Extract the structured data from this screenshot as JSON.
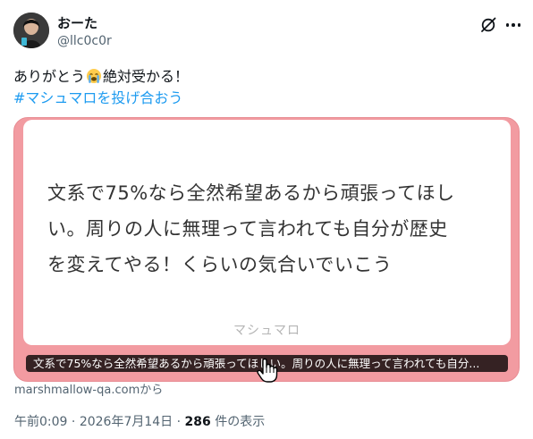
{
  "author": {
    "display_name": "おーた",
    "handle": "@llc0c0r"
  },
  "tweet": {
    "text_before_emoji": "ありがとう",
    "emoji": "loudly-crying-face-emoji",
    "text_after_emoji": "絶対受かる！",
    "hashtag": "#マシュマロを投げ合おう"
  },
  "card": {
    "message": "文系で75%なら全然希望あるから頑張ってほし\nい。周りの人に無理って言われても自分が歴史\nを変えてやる！くらいの気合いでいこう",
    "brand": "マシュマロ",
    "caption": "文系で75%なら全然希望あるから頑張ってほしい。周りの人に無理って言われても自分...",
    "source": "marshmallow-qa.comから",
    "background_color": "#f29ba1"
  },
  "meta": {
    "time": "午前0:09",
    "separator": " · ",
    "date": "2026年7月14日",
    "view_count": "286",
    "views_label": " 件の表示"
  },
  "icons": {
    "header_action": "grok-slash-icon",
    "more": "more-dots-icon",
    "cursor": "pointer-cursor-icon"
  }
}
